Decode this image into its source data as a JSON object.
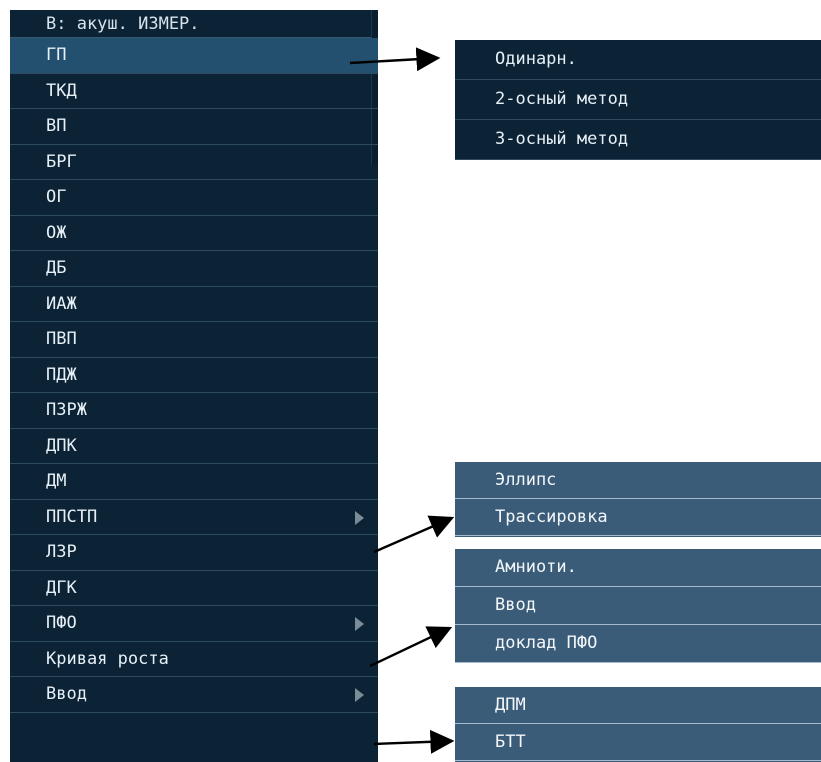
{
  "main_menu": {
    "header": "В: акуш. ИЗМЕР.",
    "items": [
      {
        "label": "ГП",
        "selected": true,
        "submenu": false
      },
      {
        "label": "ТКД",
        "submenu": false
      },
      {
        "label": "ВП",
        "submenu": false
      },
      {
        "label": "БРГ",
        "submenu": false
      },
      {
        "label": "ОГ",
        "submenu": false
      },
      {
        "label": "ОЖ",
        "submenu": false
      },
      {
        "label": "ДБ",
        "submenu": false
      },
      {
        "label": "ИАЖ",
        "submenu": false
      },
      {
        "label": "ПВП",
        "submenu": false
      },
      {
        "label": "ПДЖ",
        "submenu": false
      },
      {
        "label": "ПЗРЖ",
        "submenu": false
      },
      {
        "label": "ДПК",
        "submenu": false
      },
      {
        "label": "ДМ",
        "submenu": false
      },
      {
        "label": "ППСТП",
        "submenu": true
      },
      {
        "label": "ЛЗР",
        "submenu": false
      },
      {
        "label": "ДГК",
        "submenu": false
      },
      {
        "label": "ПФО",
        "submenu": true
      },
      {
        "label": "Кривая роста",
        "submenu": false
      },
      {
        "label": "Ввод",
        "submenu": true
      }
    ]
  },
  "submenus": {
    "gp": [
      "Одинарн.",
      "2-осный метод",
      "3-осный метод"
    ],
    "ppstp": [
      "Эллипс",
      "Трассировка"
    ],
    "pfo": [
      "Амниоти.",
      "Ввод",
      "доклад ПФО"
    ],
    "vvod": [
      "ДПМ",
      "БТТ"
    ]
  },
  "colors": {
    "menu_bg": "#0c2336",
    "selected_bg": "#23506f",
    "submenu_light_bg": "#3a5c78",
    "text": "#e7f0f6"
  }
}
